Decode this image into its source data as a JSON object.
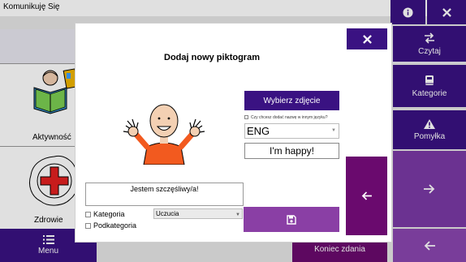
{
  "app": {
    "title": "Komunikuję Się"
  },
  "topbar": {
    "info_icon": "info-circle-icon",
    "close_icon": "close-icon"
  },
  "sidebar": {
    "items": [
      {
        "label": "Czytaj",
        "icon": "swap-arrows-icon"
      },
      {
        "label": "Kategorie",
        "icon": "book-icon"
      },
      {
        "label": "Pomyłka",
        "icon": "warning-icon"
      }
    ],
    "forward_icon": "arrow-right-icon",
    "back_icon": "arrow-left-icon"
  },
  "grid": {
    "tiles": [
      {
        "label": "Aktywność",
        "icon": "reading-child-icon"
      },
      {
        "label": "Zdrowie",
        "icon": "red-cross-icon"
      }
    ]
  },
  "bottom": {
    "menu_label": "Menu",
    "menu_icon": "list-icon",
    "end_label": "Koniec zdania"
  },
  "modal": {
    "title": "Dodaj nowy piktogram",
    "choose_photo_label": "Wybierz zdjęcie",
    "other_language_label": "Czy chcesz dodać nazwę w innym języku?",
    "language_value": "ENG",
    "translation_value": "I'm happy!",
    "name_value": "Jestem szczęśliwy/a!",
    "category_label": "Kategoria",
    "category_value": "Uczucia",
    "subcategory_label": "Podkategoria",
    "save_icon": "floppy-disk-icon",
    "close_icon": "close-icon",
    "back_icon": "arrow-left-icon"
  },
  "colors": {
    "dark_purple": "#3a1282",
    "wine": "#6a0a6e",
    "violet": "#7a3aa5",
    "light_violet": "#8a46b0"
  }
}
